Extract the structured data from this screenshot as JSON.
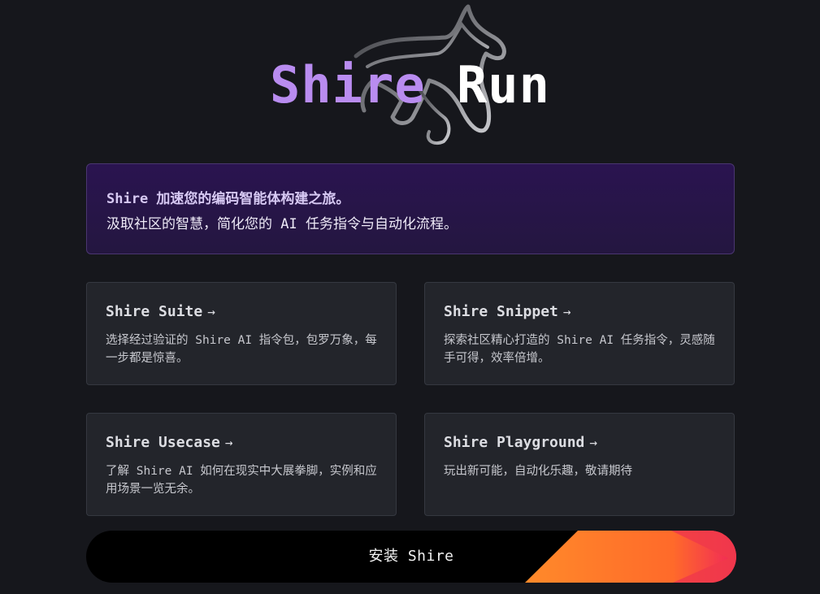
{
  "hero": {
    "title_part1": "Shire",
    "title_part2": "Run",
    "logo_icon": "horse-outline-icon"
  },
  "intro": {
    "line1": "Shire 加速您的编码智能体构建之旅。",
    "line2": "汲取社区的智慧，简化您的 AI 任务指令与自动化流程。"
  },
  "cards": [
    {
      "title": "Shire Suite",
      "arrow": "→",
      "desc": "选择经过验证的 Shire AI 指令包，包罗万象，每一步都是惊喜。"
    },
    {
      "title": "Shire Snippet",
      "arrow": "→",
      "desc": "探索社区精心打造的 Shire AI 任务指令，灵感随手可得，效率倍增。"
    },
    {
      "title": "Shire Usecase",
      "arrow": "→",
      "desc": "了解 Shire AI 如何在现实中大展拳脚，实例和应用场景一览无余。"
    },
    {
      "title": "Shire Playground",
      "arrow": "→",
      "desc": "玩出新可能，自动化乐趣，敬请期待"
    }
  ],
  "install": {
    "label": "安装 Shire"
  },
  "colors": {
    "background": "#16171c",
    "accent_purple": "#b98cf0",
    "intro_bg": "#2a1450",
    "card_bg": "#23252b",
    "install_orange": "#ff7a2a",
    "install_pink": "#f0265a"
  }
}
